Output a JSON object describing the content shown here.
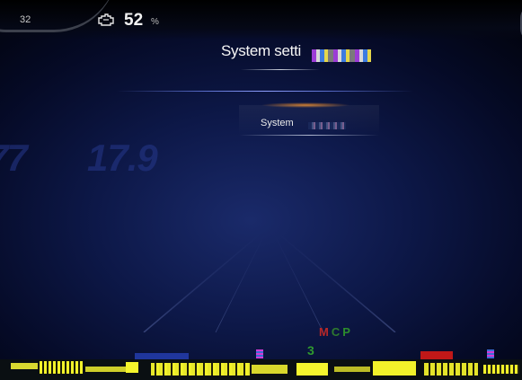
{
  "status": {
    "outside_temperature": "32",
    "engine_icon": "engine-oil-icon",
    "percent_value": "52",
    "percent_unit": "%"
  },
  "menu": {
    "title": "System setti",
    "selected_item": "System"
  },
  "background_readouts": {
    "left": "77",
    "middle": "17.9"
  },
  "gear_selector": {
    "m": "M",
    "c": "C",
    "p": "P",
    "gear_number": "3"
  },
  "colors": {
    "background": "#0d1848",
    "gear_manual": "#b82828",
    "gear_active": "#2c8c2c",
    "glitch_yellow": "#f2f22a"
  }
}
